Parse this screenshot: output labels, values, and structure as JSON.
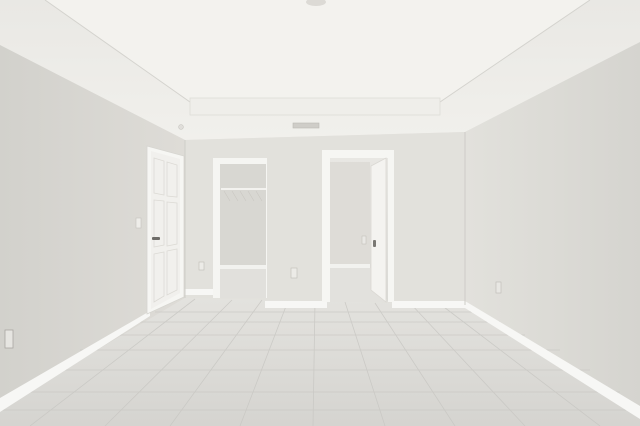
{
  "scene": {
    "subject": "empty-bedroom-interior",
    "watermark_text": "",
    "colors": {
      "ceiling": "#eceae6",
      "ceiling_tray": "#f3f2ee",
      "wall_left": "#d9d8d3",
      "wall_back": "#e3e2dd",
      "wall_right": "#dfded9",
      "floor": "#dcdbd7",
      "baseboard": "#f7f7f5",
      "door": "#f2f1ee",
      "door_frame": "#f6f6f3",
      "closet": "#d7d6d1"
    }
  }
}
